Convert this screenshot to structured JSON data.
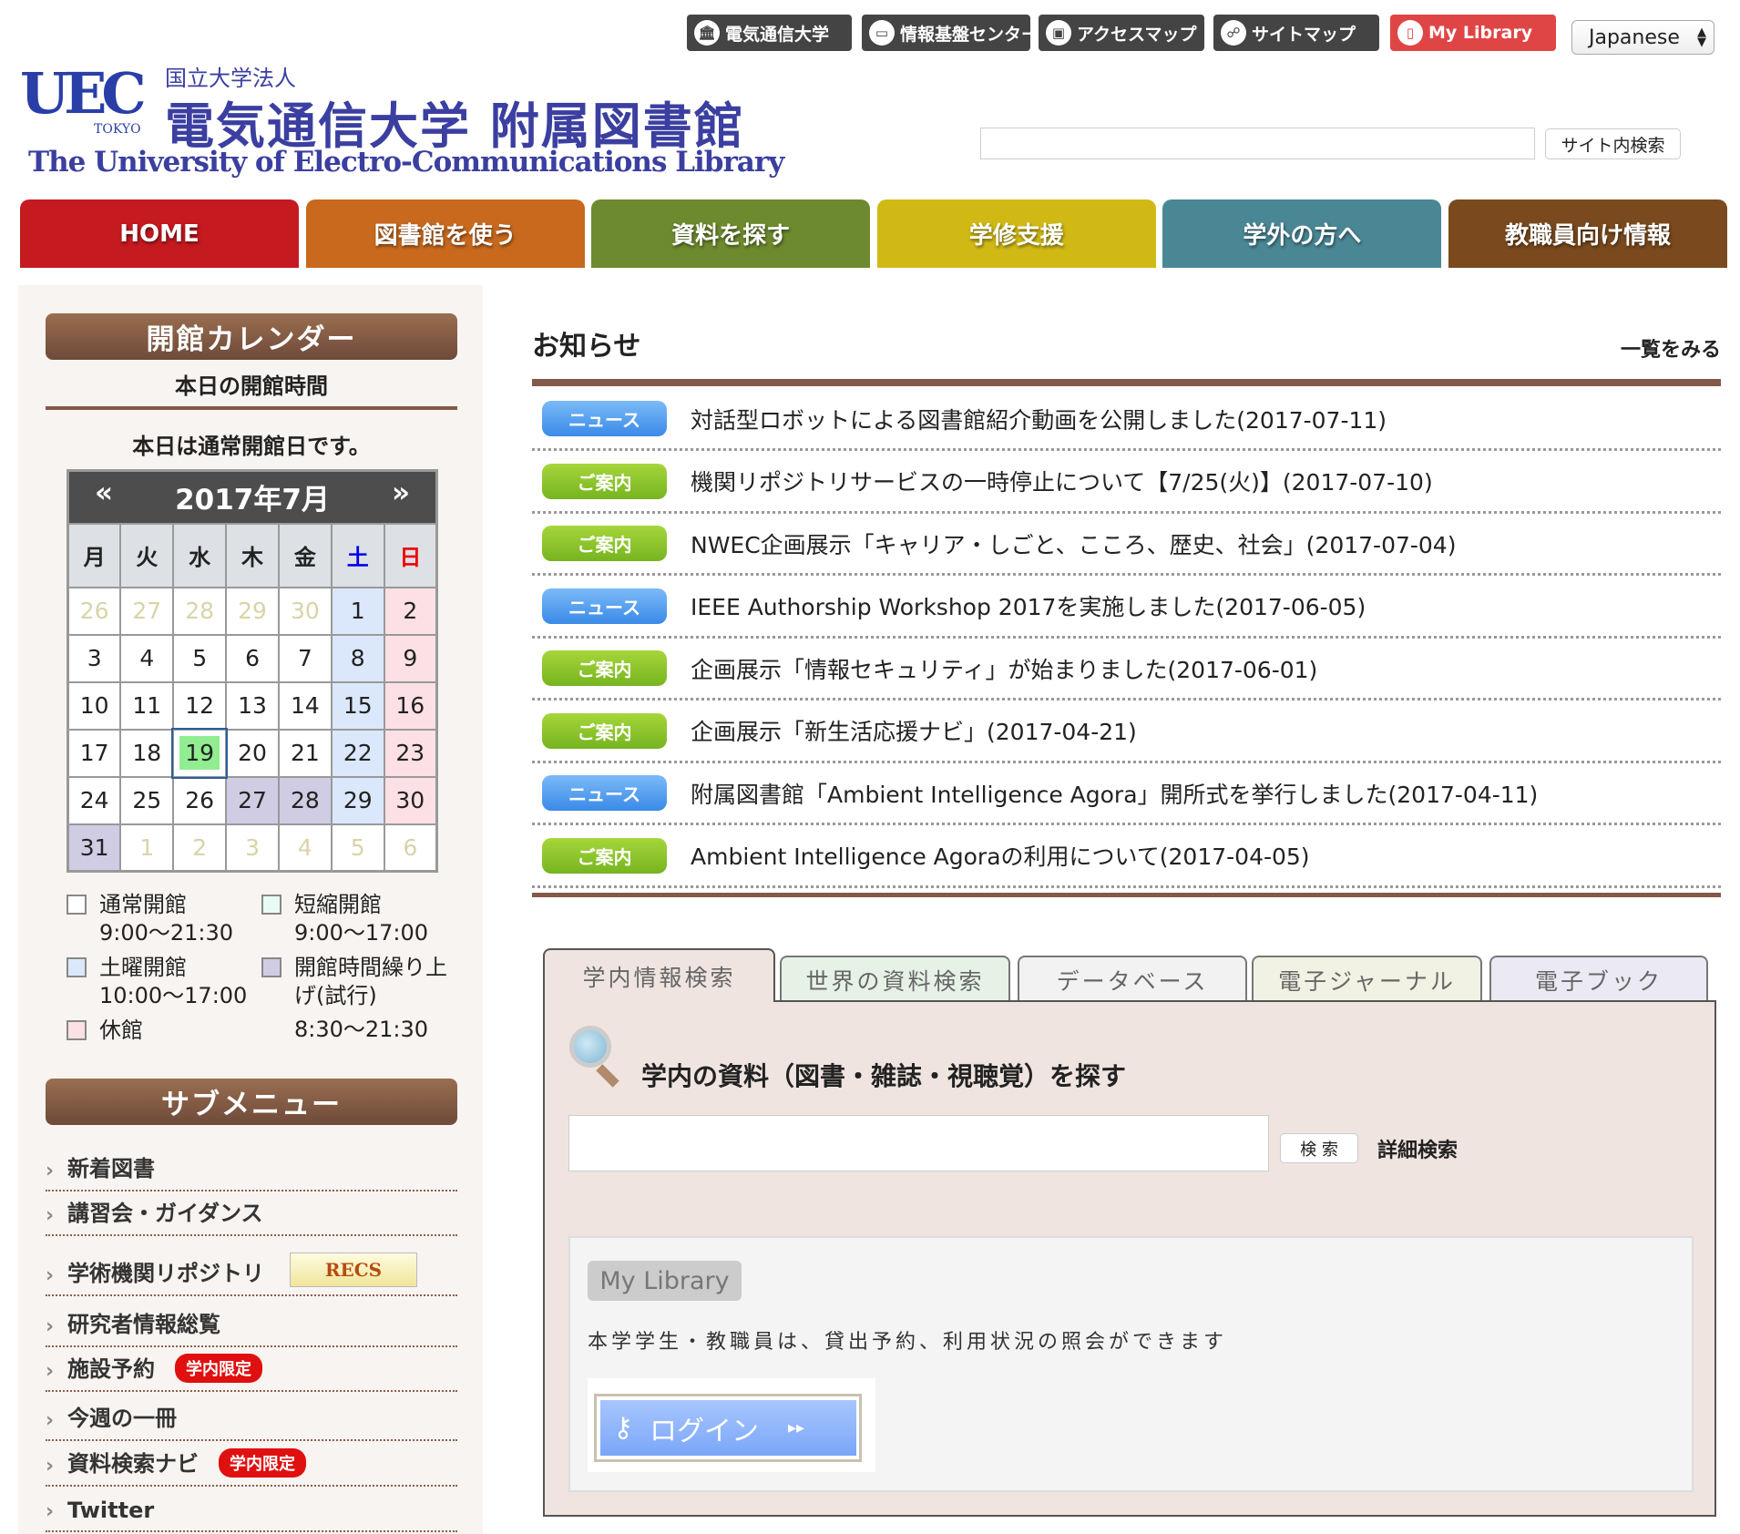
{
  "top_links": [
    {
      "label": "電気通信大学",
      "icon": "university-icon"
    },
    {
      "label": "情報基盤センター",
      "icon": "monitor-icon"
    },
    {
      "label": "アクセスマップ",
      "icon": "train-icon"
    },
    {
      "label": "サイトマップ",
      "icon": "sitemap-icon"
    },
    {
      "label": "My Library",
      "icon": "tablet-icon"
    }
  ],
  "language": {
    "selected": "Japanese"
  },
  "logo": {
    "uec": "UEC",
    "tokyo": "TOKYO",
    "sub": "国立大学法人",
    "main": "電気通信大学 附属図書館",
    "english": "The University of Electro-Communications Library"
  },
  "site_search": {
    "value": "",
    "button": "サイト内検索"
  },
  "nav": [
    {
      "label": "HOME",
      "color": "#c41a20"
    },
    {
      "label": "図書館を使う",
      "color": "#c8691e"
    },
    {
      "label": "資料を探す",
      "color": "#6e8a2e"
    },
    {
      "label": "学修支援",
      "color": "#d0b915"
    },
    {
      "label": "学外の方へ",
      "color": "#4a8795"
    },
    {
      "label": "教職員向け情報",
      "color": "#7a4a1e"
    }
  ],
  "calendar": {
    "heading": "開館カレンダー",
    "today_hours_label": "本日の開館時間",
    "today_status": "本日は通常開館日です。",
    "prev": "«",
    "next": "»",
    "month": "2017年7月",
    "weekdays": [
      "月",
      "火",
      "水",
      "木",
      "金",
      "土",
      "日"
    ],
    "weeks": [
      [
        [
          "26",
          "other"
        ],
        [
          "27",
          "other"
        ],
        [
          "28",
          "other"
        ],
        [
          "29",
          "other"
        ],
        [
          "30",
          "other"
        ],
        [
          "1",
          "sat"
        ],
        [
          "2",
          "sun"
        ]
      ],
      [
        [
          "3",
          "normal"
        ],
        [
          "4",
          "normal"
        ],
        [
          "5",
          "normal"
        ],
        [
          "6",
          "normal"
        ],
        [
          "7",
          "normal"
        ],
        [
          "8",
          "sat"
        ],
        [
          "9",
          "sun"
        ]
      ],
      [
        [
          "10",
          "normal"
        ],
        [
          "11",
          "normal"
        ],
        [
          "12",
          "normal"
        ],
        [
          "13",
          "normal"
        ],
        [
          "14",
          "normal"
        ],
        [
          "15",
          "sat"
        ],
        [
          "16",
          "sun"
        ]
      ],
      [
        [
          "17",
          "normal"
        ],
        [
          "18",
          "normal"
        ],
        [
          "19",
          "today"
        ],
        [
          "20",
          "normal"
        ],
        [
          "21",
          "normal"
        ],
        [
          "22",
          "sat"
        ],
        [
          "23",
          "sun"
        ]
      ],
      [
        [
          "24",
          "normal"
        ],
        [
          "25",
          "normal"
        ],
        [
          "26",
          "normal"
        ],
        [
          "27",
          "extended"
        ],
        [
          "28",
          "extended"
        ],
        [
          "29",
          "sat"
        ],
        [
          "30",
          "sun"
        ]
      ],
      [
        [
          "31",
          "extended"
        ],
        [
          "1",
          "other"
        ],
        [
          "2",
          "other"
        ],
        [
          "3",
          "other"
        ],
        [
          "4",
          "other"
        ],
        [
          "5",
          "other"
        ],
        [
          "6",
          "other"
        ]
      ]
    ],
    "colors": {
      "sat": "#dbe8fb",
      "sun": "#fde0e6",
      "extended": "#d0cce4",
      "today": "#90ee90",
      "other_text": "#d8d4a8"
    },
    "legend": [
      {
        "label": "通常開館",
        "hours": "9:00〜21:30",
        "color": "#ffffff"
      },
      {
        "label": "短縮開館",
        "hours": "9:00〜17:00",
        "color": "#e8fbf4"
      },
      {
        "label": "土曜開館",
        "hours": "10:00〜17:00",
        "color": "#dbe8fb"
      },
      {
        "label": "開館時間繰り上げ(試行)",
        "hours": "8:30〜21:30",
        "color": "#d0cce4"
      },
      {
        "label": "休館",
        "hours": "",
        "color": "#fde0e6"
      }
    ]
  },
  "submenu": {
    "heading": "サブメニュー",
    "items": [
      {
        "label": "新着図書"
      },
      {
        "label": "講習会・ガイダンス"
      },
      {
        "label": "学術機関リポジトリ",
        "banner": "RECS"
      },
      {
        "label": "研究者情報総覧"
      },
      {
        "label": "施設予約",
        "badge": "学内限定"
      },
      {
        "label": "今週の一冊"
      },
      {
        "label": "資料検索ナビ",
        "badge": "学内限定"
      },
      {
        "label": "Twitter"
      }
    ]
  },
  "news": {
    "title": "お知らせ",
    "more": "一覧をみる",
    "items": [
      {
        "type": "news",
        "badge": "ニュース",
        "text": "対話型ロボットによる図書館紹介動画を公開しました(2017-07-11)"
      },
      {
        "type": "info",
        "badge": "ご案内",
        "text": "機関リポジトリサービスの一時停止について【7/25(火)】(2017-07-10)"
      },
      {
        "type": "info",
        "badge": "ご案内",
        "text": "NWEC企画展示「キャリア・しごと、こころ、歴史、社会」(2017-07-04)"
      },
      {
        "type": "news",
        "badge": "ニュース",
        "text": "IEEE Authorship Workshop 2017を実施しました(2017-06-05)"
      },
      {
        "type": "info",
        "badge": "ご案内",
        "text": "企画展示「情報セキュリティ」が始まりました(2017-06-01)"
      },
      {
        "type": "info",
        "badge": "ご案内",
        "text": "企画展示「新生活応援ナビ」(2017-04-21)"
      },
      {
        "type": "news",
        "badge": "ニュース",
        "text": "附属図書館「Ambient Intelligence Agora」開所式を挙行しました(2017-04-11)"
      },
      {
        "type": "info",
        "badge": "ご案内",
        "text": "Ambient Intelligence Agoraの利用について(2017-04-05)"
      }
    ]
  },
  "search_tabs": [
    {
      "label": "学内情報検索",
      "bg": "#efe4e0"
    },
    {
      "label": "世界の資料検索",
      "bg": "#e6f2e6"
    },
    {
      "label": "データベース",
      "bg": "#f2f2f2"
    },
    {
      "label": "電子ジャーナル",
      "bg": "#f1f1e4"
    },
    {
      "label": "電子ブック",
      "bg": "#ebe9f3"
    }
  ],
  "search_panel": {
    "heading": "学内の資料（図書・雑誌・視聴覚）を探す",
    "value": "",
    "button": "検 索",
    "advanced": "詳細検索",
    "mylibrary": {
      "label": "My Library",
      "description": "本学学生・教職員は、貸出予約、利用状況の照会ができます",
      "login": "ログイン"
    }
  }
}
